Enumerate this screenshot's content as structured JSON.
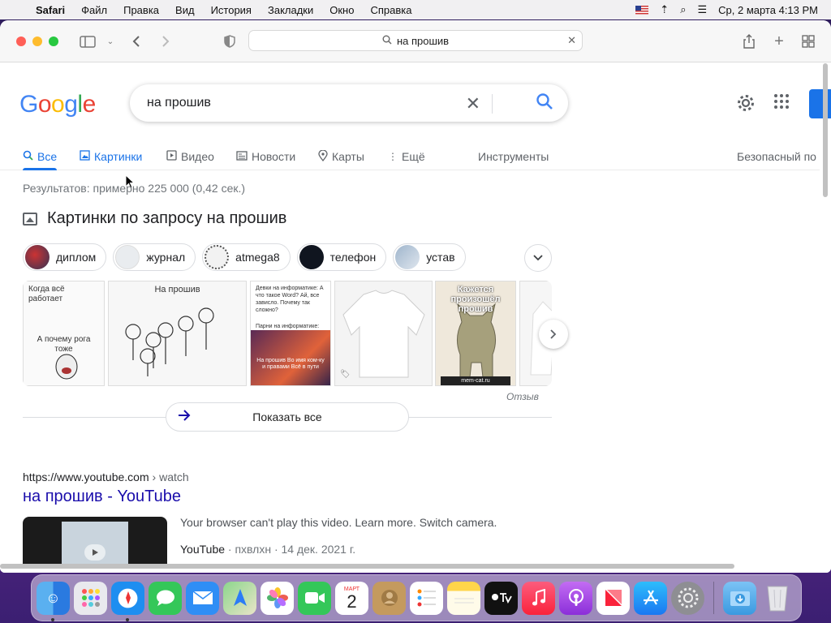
{
  "menubar": {
    "app_name": "Safari",
    "items": [
      "Файл",
      "Правка",
      "Вид",
      "История",
      "Закладки",
      "Окно",
      "Справка"
    ],
    "datetime": "Сp, 2 марта  4:13 PM"
  },
  "browser": {
    "address_text": "на прошив"
  },
  "google": {
    "logo_letters": [
      "G",
      "o",
      "o",
      "g",
      "l",
      "e"
    ],
    "query": "на прошив",
    "tabs": [
      "Все",
      "Картинки",
      "Видео",
      "Новости",
      "Карты",
      "Ещё",
      "Инструменты",
      "Безопасный по"
    ],
    "stats": "Результатов: примерно 225 000 (0,42 сек.)",
    "images_heading": "Картинки по запросу на прошив",
    "chips": [
      "диплом",
      "журнал",
      "atmega8",
      "телефон",
      "устав"
    ],
    "image_captions": [
      "Когда всё работает",
      "А почему рога тоже",
      "На прошив",
      "Девки на информатике: А что такое Word? Ай, все зависло. Почему так сложно?",
      "Парни на информатике:",
      "На прошив Во имя ком-ку и правами Всё в пути",
      "Кажется произошёл прошив",
      "mem-cat.ru"
    ],
    "feedback": "Отзыв",
    "show_all": "Показать все",
    "result": {
      "url_domain": "https://www.youtube.com",
      "url_path": " › watch",
      "title": "на прошив - YouTube",
      "snippet": "Your browser can't play this video. Learn more. Switch camera.",
      "source": "YouTube",
      "meta": " · пхвлхн · 14 дек. 2021 г."
    }
  },
  "dock": {
    "apps": [
      "finder-icon",
      "launchpad-icon",
      "safari-icon",
      "messages-icon",
      "mail-icon",
      "maps-icon",
      "photos-icon",
      "facetime-icon",
      "calendar-icon",
      "contacts-icon",
      "reminders-icon",
      "notes-icon",
      "appletv-icon",
      "music-icon",
      "podcasts-icon",
      "news-icon",
      "appstore-icon",
      "settings-icon",
      "downloads-icon",
      "trash-icon"
    ],
    "calendar_month": "МАРТ",
    "calendar_day": "2"
  },
  "colors": {
    "google_blue": "#1a73e8",
    "link_title": "#1a0dab",
    "accent_blue": "#4285f4"
  }
}
